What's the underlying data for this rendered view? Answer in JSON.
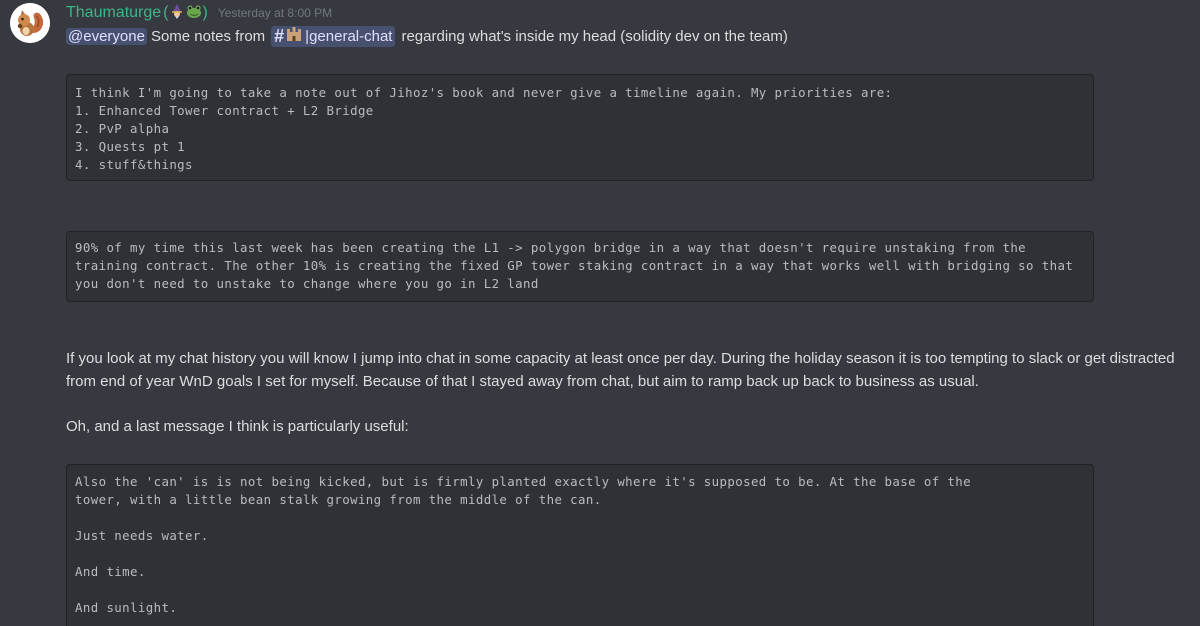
{
  "message": {
    "username": "Thaumaturge",
    "username_emoji_open": "(",
    "username_emoji_close": ")",
    "timestamp": "Yesterday at 8:00 PM",
    "mention": "@everyone",
    "intro_text_before_channel": "Some notes from",
    "channel_name": "general-chat",
    "intro_text_after_channel": "regarding what's inside my head (solidity dev on the team)",
    "code_block_1": "I think I'm going to take a note out of Jihoz's book and never give a timeline again. My priorities are:\n1. Enhanced Tower contract + L2 Bridge\n2. PvP alpha\n3. Quests pt 1\n4. stuff&things",
    "code_block_2": "90% of my time this last week has been creating the L1 -> polygon bridge in a way that doesn't require unstaking from the training contract. The other 10% is creating the fixed GP tower staking contract in a way that works well with bridging so that you don't need to unstake to change where you go in L2 land",
    "paragraph_1": "If you look at my chat history you will know I jump into chat in some capacity at least once per day. During the holiday season it is too tempting to slack or get distracted from end of year WnD goals I set for myself. Because of that I stayed away from chat, but aim to ramp back up back to business as usual.",
    "paragraph_2": "Oh, and a last message I think is particularly useful:",
    "code_block_3": "Also the 'can' is is not being kicked, but is firmly planted exactly where it's supposed to be. At the base of the\ntower, with a little bean stalk growing from the middle of the can.\n\nJust needs water.\n\nAnd time.\n\nAnd sunlight."
  },
  "colors": {
    "background": "#36393f",
    "code_background": "#2f3136",
    "username": "#3eb489",
    "mention_background": "#414675",
    "timestamp": "#72767d",
    "text": "#dcddde"
  },
  "icons": {
    "avatar": "squirrel-avatar-icon",
    "channel_prefix": "hash-icon",
    "channel_emoji": "castle-icon",
    "username_emoji_1": "wizard-emoji-icon",
    "username_emoji_2": "frog-emoji-icon"
  }
}
